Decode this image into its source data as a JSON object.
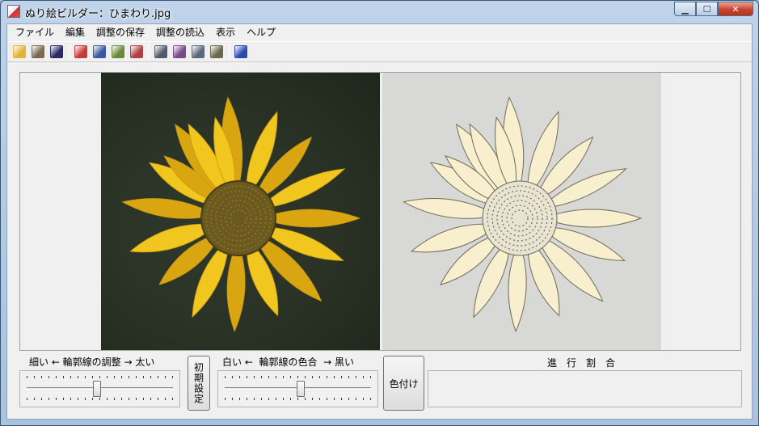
{
  "window": {
    "title": "ぬり絵ビルダー：ひまわり.jpg",
    "caption_buttons": {
      "minimize": "▁",
      "maximize": "☐",
      "close": "✕"
    }
  },
  "menu": [
    "ファイル",
    "編集",
    "調整の保存",
    "調整の読込",
    "表示",
    "ヘルプ"
  ],
  "toolbar": {
    "groups": [
      [
        {
          "icon": "open-folder-icon",
          "color": "#e0b43a"
        },
        {
          "icon": "adjust-icon",
          "color": "#7a6a50"
        },
        {
          "icon": "save-disk-icon",
          "color": "#2b2b6a"
        }
      ],
      [
        {
          "icon": "close-image-icon",
          "color": "#c83a3a"
        },
        {
          "icon": "zoom-icon",
          "color": "#3a5aa0"
        },
        {
          "icon": "edit-icon",
          "color": "#6a8a3a"
        },
        {
          "icon": "export-icon",
          "color": "#b04040"
        }
      ],
      [
        {
          "icon": "print-icon",
          "color": "#505a6a"
        },
        {
          "icon": "print-setup-icon",
          "color": "#7a4a8a"
        },
        {
          "icon": "print-preview-icon",
          "color": "#5a6a7a"
        },
        {
          "icon": "printer-options-icon",
          "color": "#6a6a50"
        }
      ],
      [
        {
          "icon": "help-icon",
          "color": "#2a4ab0"
        }
      ]
    ]
  },
  "controls": {
    "outline_width_label": "細い ← 輪郭線の調整 → 太い",
    "outline_width_value": 0.48,
    "reset_button": "初期設定",
    "outline_color_label": "白い ←  輪郭線の色合  → 黒い",
    "outline_color_value": 0.52,
    "colorize_button": "色付け",
    "progress_label": "進　行　割　合",
    "progress_value": 0
  },
  "colors": {
    "petal": "#f1c61e",
    "petal_dark": "#d9a612",
    "center": "#6b5a1f",
    "line_petal_fill": "#f7efcd",
    "line_stroke": "#6e6a5a"
  }
}
